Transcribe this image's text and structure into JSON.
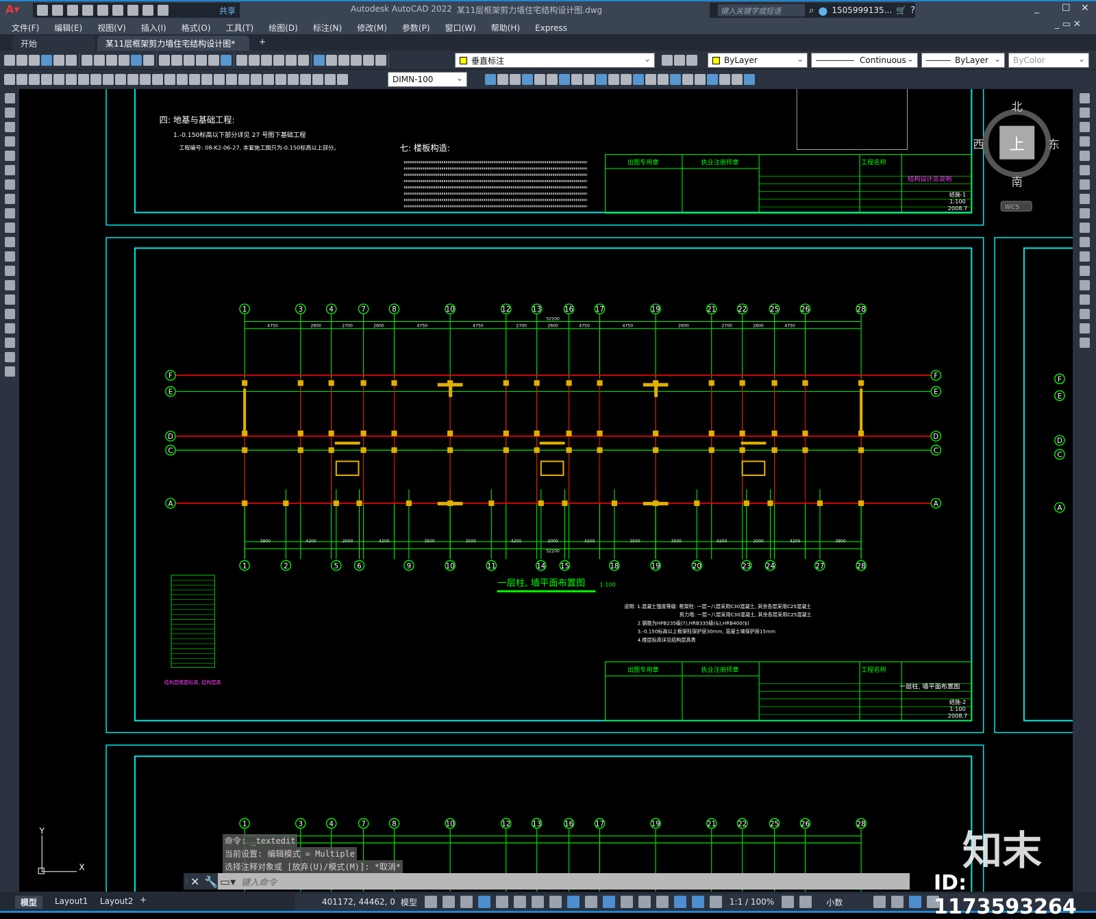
{
  "app": {
    "title": "Autodesk AutoCAD 2022",
    "file": "某11层框架剪力墙住宅结构设计图.dwg",
    "search_placeholder": "键入关键字或短语",
    "user": "1505999135...",
    "share": "共享"
  },
  "menu": [
    "文件(F)",
    "编辑(E)",
    "视图(V)",
    "插入(I)",
    "格式(O)",
    "工具(T)",
    "绘图(D)",
    "标注(N)",
    "修改(M)",
    "参数(P)",
    "窗口(W)",
    "帮助(H)",
    "Express"
  ],
  "tabs": {
    "start": "开始",
    "active": "某11层框架剪力墙住宅结构设计图*"
  },
  "toolbar": {
    "layer": "垂直标注",
    "color": "ByLayer",
    "linetype": "Continuous",
    "lineweight": "ByLayer",
    "plotstyle": "ByColor",
    "dimstyle": "DIMN-100"
  },
  "icons": {
    "qat": [
      "new-icon",
      "open-icon",
      "save-icon",
      "save-as-icon",
      "plot-preview-icon",
      "mobile-icon",
      "print-icon",
      "undo-icon",
      "redo-icon"
    ],
    "left": [
      "line-icon",
      "construction-line-icon",
      "polyline-icon",
      "polygon-icon",
      "rectangle-icon",
      "arc-icon",
      "circle-icon",
      "revision-cloud-icon",
      "spline-icon",
      "ellipse-icon",
      "ellipse-arc-icon",
      "insert-block-icon",
      "make-block-icon",
      "point-icon",
      "hatch-icon",
      "gradient-icon",
      "region-icon",
      "table-icon",
      "mtext-icon",
      "add-selected-icon"
    ],
    "right": [
      "erase-icon",
      "copy-icon",
      "mirror-icon",
      "offset-icon",
      "array-icon",
      "move-icon",
      "rotate-icon",
      "scale-icon",
      "stretch-icon",
      "trim-icon",
      "extend-icon",
      "break-point-icon",
      "break-icon",
      "join-icon",
      "chamfer-icon",
      "fillet-icon",
      "blend-icon",
      "explode-icon"
    ]
  },
  "compass": {
    "n": "北",
    "s": "南",
    "e": "东",
    "w": "西",
    "top": "上",
    "wcs": "WCS"
  },
  "drawing": {
    "plan_title": "一层柱, 墙平面布置图",
    "plan_scale": "1:100",
    "top_axes": [
      "1",
      "3",
      "4",
      "7",
      "8",
      "10",
      "12",
      "13",
      "16",
      "17",
      "19",
      "21",
      "22",
      "25",
      "26",
      "28"
    ],
    "bottom_axes": [
      "1",
      "2",
      "5",
      "6",
      "9",
      "10",
      "11",
      "14",
      "15",
      "18",
      "19",
      "20",
      "23",
      "24",
      "27",
      "28"
    ],
    "rows": [
      "F",
      "E",
      "D",
      "C",
      "A"
    ],
    "top_dims": [
      "4750",
      "2600",
      "2700",
      "2600",
      "4750",
      "4750",
      "2700",
      "2600",
      "4750",
      "4750",
      "2600",
      "2700",
      "2600",
      "4750"
    ],
    "bottom_dims": [
      "3900",
      "4200",
      "2000",
      "4200",
      "3500",
      "3500",
      "4200",
      "2000",
      "4200",
      "3500",
      "3500",
      "4200",
      "2000",
      "4200",
      "3900"
    ],
    "total_dim": "52200",
    "notes": [
      "说明: 1.混凝土强度等级: 框架柱: 一层~八层采用C30混凝土, 其余各层采用C25混凝土",
      "剪力墙: 一层~八层采用C30混凝土, 其余各层采用C25混凝土",
      "2.钢筋为HPB235级(?),HRB335级(&),HRB400($)",
      "3.-0.150标高以上框架柱保护层30mm, 混凝土墙保护层15mm",
      "4.楼层标高详见结构层高表"
    ],
    "top_notes": [
      "四: 地基与基础工程:",
      "1.-0.150标高以下部分详见  27 号图下基础工程",
      "工程编号: 08-K2-06-27, 本套施工图只为-0.150标高以上部分。",
      "七: 楼板构造:"
    ],
    "titleblock": {
      "stamp1": "出图专用章",
      "stamp2": "执业注册师章",
      "project": "工程名称",
      "drawing1": "结构设计总说明",
      "drawing2": "一层柱, 墙平面布置图",
      "scale": "1:100",
      "date": "2008.7",
      "no1": "结施-1",
      "no2": "结施-2"
    },
    "floor_table_title": "结构层楼面标高, 结构层高"
  },
  "command": {
    "lines": [
      "命令: _textedit",
      "当前设置: 编辑模式 = Multiple",
      "选择注释对象或 [放弃(U)/模式(M)]: *取消*"
    ],
    "placeholder": "键入命令"
  },
  "status": {
    "layouts": [
      "模型",
      "Layout1",
      "Layout2"
    ],
    "coords": "401172, 44462, 0",
    "space": "模型",
    "scale": "1:1 / 100%",
    "units": "小数"
  },
  "watermark": {
    "brand": "知末",
    "id": "ID: 1173593264"
  },
  "colors": {
    "frame": "#00e5e5",
    "axis": "#00ff00",
    "beam": "#ff0000",
    "column": "#e0b000",
    "text": "#ffffff"
  }
}
